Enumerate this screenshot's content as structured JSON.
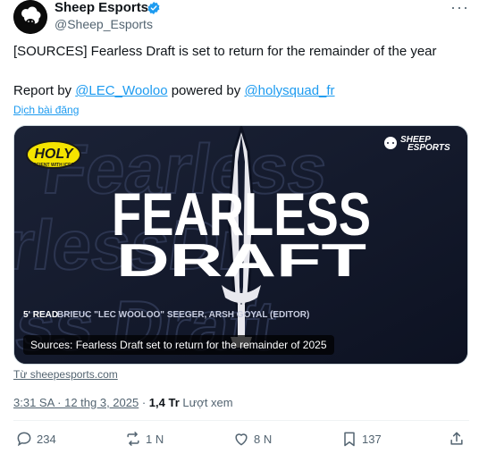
{
  "author": {
    "name": "Sheep Esports",
    "handle": "@Sheep_Esports"
  },
  "tweet": {
    "line1": "[SOURCES] Fearless Draft is set to return for the remainder of the year",
    "line2_prefix": "Report by ",
    "mention1": "@LEC_Wooloo",
    "line2_middle": " powered by ",
    "mention2": "@holysquad_fr",
    "translate_label": "Dịch bài đăng"
  },
  "card": {
    "holy_logo": "HOLY",
    "holy_tagline": "SCIENT WITH ICES",
    "brand_line1": "SHEEP",
    "brand_line2": "ESPORTS",
    "headline_top": "FEARLESS",
    "headline_bottom": "DRAFT",
    "read_time": "5' READ",
    "authors": "BRIEUC \"LEC WOOLOO\" SEEGER, ARSH GOYAL (EDITOR)",
    "caption": "Sources: Fearless Draft set to return for the remainder of 2025",
    "domain": "Từ sheepesports.com"
  },
  "meta": {
    "time": "3:31 SA · 12 thg 3, 2025",
    "separator": " · ",
    "views_count": "1,4 Tr",
    "views_label": " Lượt xem"
  },
  "actions": {
    "replies": "234",
    "reposts": "1 N",
    "likes": "8 N",
    "bookmarks": "137"
  },
  "colors": {
    "accent": "#1d9bf0",
    "text": "#0f1419",
    "muted": "#536471",
    "card_bg": "#141a2e",
    "holy_yellow": "#f5e400"
  }
}
